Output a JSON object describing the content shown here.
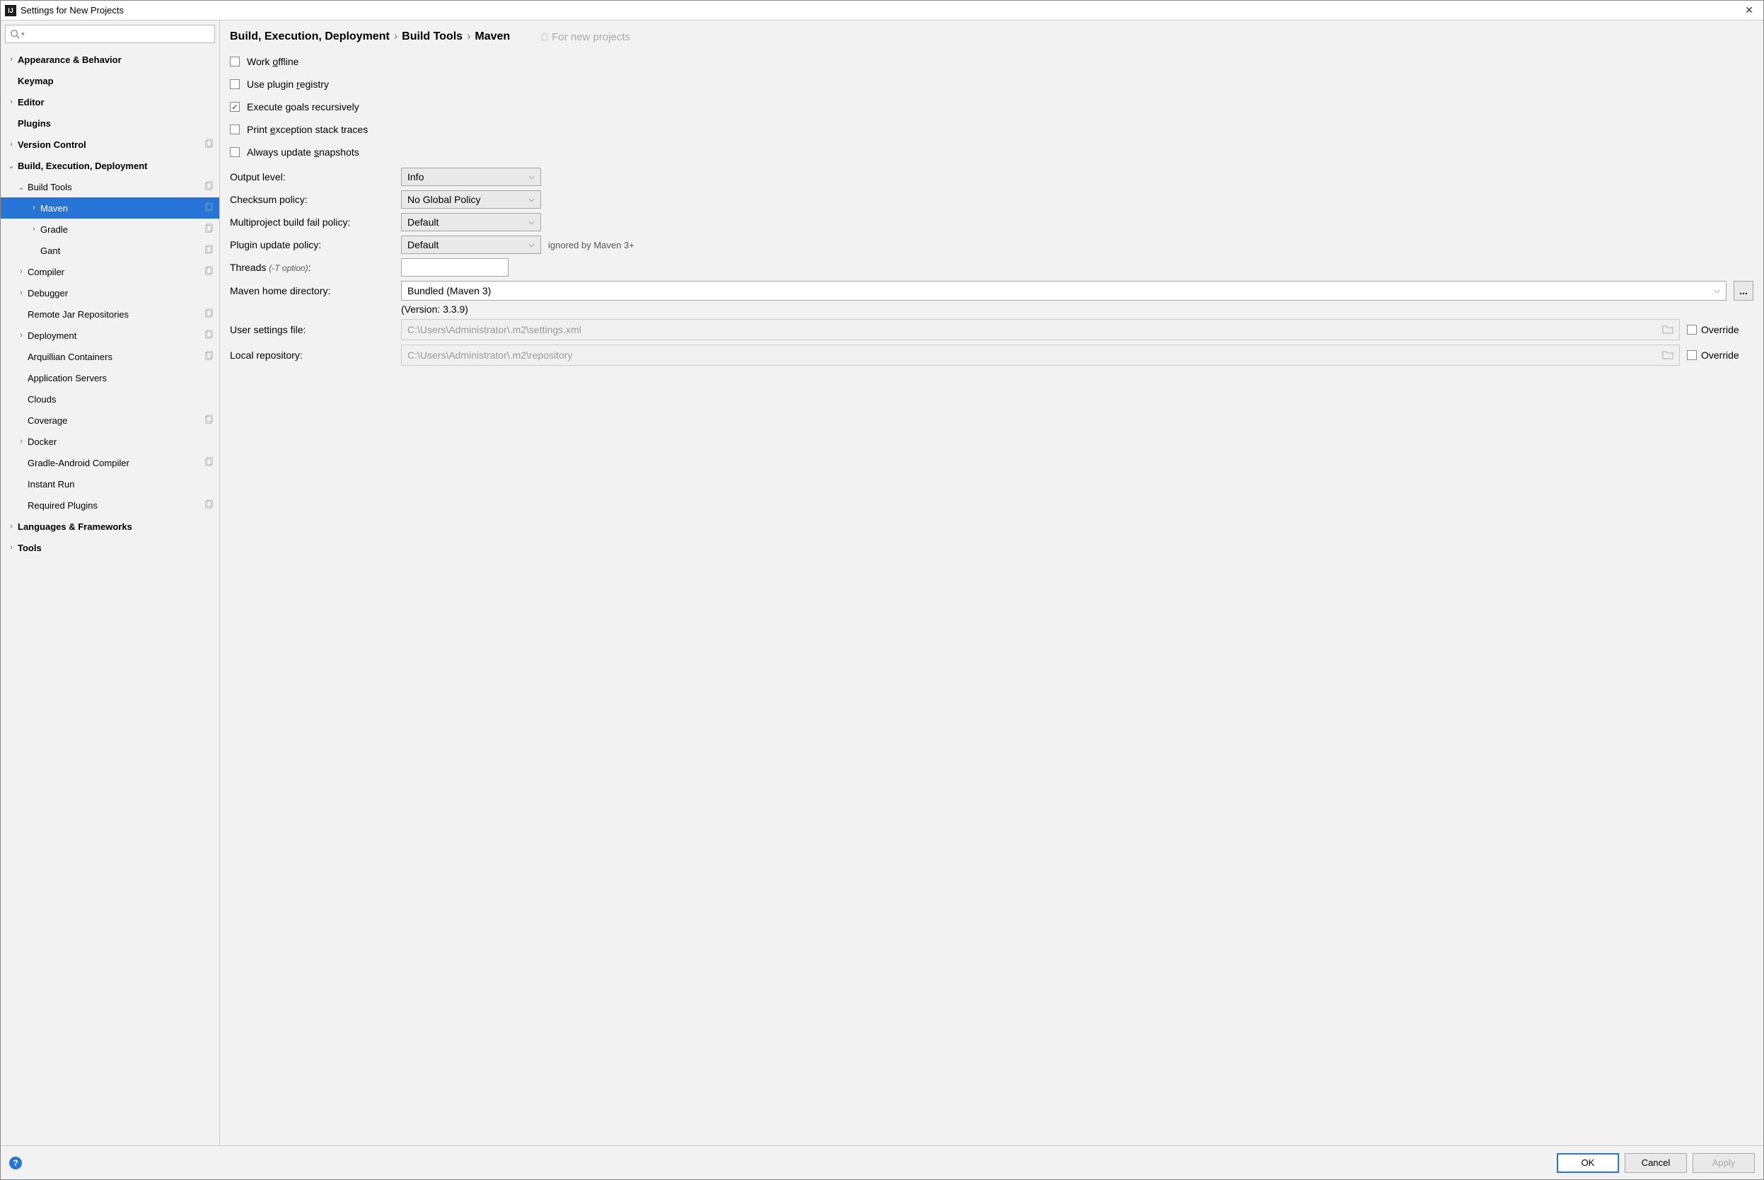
{
  "window": {
    "title": "Settings for New Projects"
  },
  "search": {
    "placeholder": ""
  },
  "sidebar": {
    "items": [
      {
        "label": "Appearance & Behavior",
        "level": 0,
        "arrow": "right",
        "bold": true,
        "copy": false
      },
      {
        "label": "Keymap",
        "level": 0,
        "arrow": "none",
        "bold": true,
        "copy": false
      },
      {
        "label": "Editor",
        "level": 0,
        "arrow": "right",
        "bold": true,
        "copy": false
      },
      {
        "label": "Plugins",
        "level": 0,
        "arrow": "none",
        "bold": true,
        "copy": false
      },
      {
        "label": "Version Control",
        "level": 0,
        "arrow": "right",
        "bold": true,
        "copy": true
      },
      {
        "label": "Build, Execution, Deployment",
        "level": 0,
        "arrow": "down",
        "bold": true,
        "copy": false
      },
      {
        "label": "Build Tools",
        "level": 1,
        "arrow": "down",
        "bold": false,
        "copy": true
      },
      {
        "label": "Maven",
        "level": 2,
        "arrow": "right",
        "bold": false,
        "copy": true,
        "selected": true
      },
      {
        "label": "Gradle",
        "level": 2,
        "arrow": "right",
        "bold": false,
        "copy": true
      },
      {
        "label": "Gant",
        "level": 2,
        "arrow": "none",
        "bold": false,
        "copy": true
      },
      {
        "label": "Compiler",
        "level": 1,
        "arrow": "right",
        "bold": false,
        "copy": true
      },
      {
        "label": "Debugger",
        "level": 1,
        "arrow": "right",
        "bold": false,
        "copy": false
      },
      {
        "label": "Remote Jar Repositories",
        "level": 1,
        "arrow": "none",
        "bold": false,
        "copy": true
      },
      {
        "label": "Deployment",
        "level": 1,
        "arrow": "right",
        "bold": false,
        "copy": true
      },
      {
        "label": "Arquillian Containers",
        "level": 1,
        "arrow": "none",
        "bold": false,
        "copy": true
      },
      {
        "label": "Application Servers",
        "level": 1,
        "arrow": "none",
        "bold": false,
        "copy": false
      },
      {
        "label": "Clouds",
        "level": 1,
        "arrow": "none",
        "bold": false,
        "copy": false
      },
      {
        "label": "Coverage",
        "level": 1,
        "arrow": "none",
        "bold": false,
        "copy": true
      },
      {
        "label": "Docker",
        "level": 1,
        "arrow": "right",
        "bold": false,
        "copy": false
      },
      {
        "label": "Gradle-Android Compiler",
        "level": 1,
        "arrow": "none",
        "bold": false,
        "copy": true
      },
      {
        "label": "Instant Run",
        "level": 1,
        "arrow": "none",
        "bold": false,
        "copy": false
      },
      {
        "label": "Required Plugins",
        "level": 1,
        "arrow": "none",
        "bold": false,
        "copy": true
      },
      {
        "label": "Languages & Frameworks",
        "level": 0,
        "arrow": "right",
        "bold": true,
        "copy": false
      },
      {
        "label": "Tools",
        "level": 0,
        "arrow": "right",
        "bold": true,
        "copy": false
      }
    ]
  },
  "breadcrumb": {
    "c1": "Build, Execution, Deployment",
    "c2": "Build Tools",
    "c3": "Maven",
    "note": "For new projects"
  },
  "checks": {
    "work_offline": "Work offline",
    "plugin_registry": "Use plugin registry",
    "exec_recursive": "Execute goals recursively",
    "print_exc": "Print exception stack traces",
    "update_snap": "Always update snapshots"
  },
  "form": {
    "output_level_label": "Output level:",
    "output_level_value": "Info",
    "checksum_label": "Checksum policy:",
    "checksum_value": "No Global Policy",
    "fail_label": "Multiproject build fail policy:",
    "fail_value": "Default",
    "plugin_update_label": "Plugin update policy:",
    "plugin_update_value": "Default",
    "plugin_update_hint": "ignored by Maven 3+",
    "threads_label": "Threads ",
    "threads_hint": "(-T option)",
    "threads_value": "",
    "home_label": "Maven home directory:",
    "home_value": "Bundled (Maven 3)",
    "version": "(Version: 3.3.9)",
    "user_settings_label": "User settings file:",
    "user_settings_value": "C:\\Users\\Administrator\\.m2\\settings.xml",
    "local_repo_label": "Local repository:",
    "local_repo_value": "C:\\Users\\Administrator\\.m2\\repository",
    "override_label": "Override",
    "browse_label": "..."
  },
  "footer": {
    "ok": "OK",
    "cancel": "Cancel",
    "apply": "Apply"
  }
}
